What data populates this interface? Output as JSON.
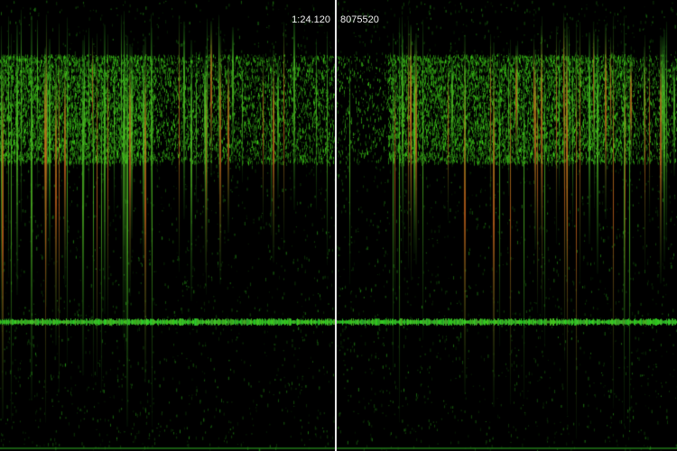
{
  "playhead": {
    "time_label": "1:24.120",
    "sample_label": "8075520"
  },
  "colors": {
    "background": "#000000",
    "playhead": "#e8e8e8",
    "readout_text": "#f2f2f2",
    "spectrum_low": "#1d6b1a",
    "spectrum_mid": "#3fbf2a",
    "spectrum_high": "#d06a1c"
  }
}
